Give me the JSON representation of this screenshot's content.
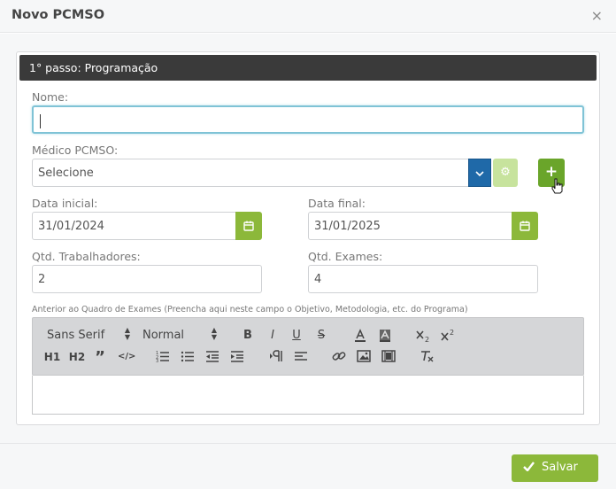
{
  "modal": {
    "title": "Novo PCMSO",
    "close_glyph": "×"
  },
  "panel": {
    "heading": "1° passo: Programação"
  },
  "form": {
    "nome_label": "Nome:",
    "nome_value": "",
    "medico_label": "Médico PCMSO:",
    "medico_value": "Selecione",
    "data_inicial_label": "Data inicial:",
    "data_inicial_value": "31/01/2024",
    "data_final_label": "Data final:",
    "data_final_value": "31/01/2025",
    "qtd_trabalhadores_label": "Qtd. Trabalhadores:",
    "qtd_trabalhadores_value": "2",
    "qtd_exames_label": "Qtd. Exames:",
    "qtd_exames_value": "4",
    "anterior_label": "Anterior ao Quadro de Exames (Preencha aqui neste campo o Objetivo, Metodologia, etc. do Programa)"
  },
  "editor_toolbar": {
    "font_family": "Sans Serif",
    "font_size": "Normal",
    "bold": "B",
    "italic": "I",
    "underline": "U",
    "strike": "S",
    "h1": "H1",
    "h2": "H2",
    "quote": "”",
    "code": "</>"
  },
  "footer": {
    "save_label": "Salvar"
  },
  "colors": {
    "accent_green": "#8cb83a",
    "dark_green": "#6aa52a",
    "select_blue": "#1f69a8",
    "heading_bg": "#3a3a3a"
  }
}
